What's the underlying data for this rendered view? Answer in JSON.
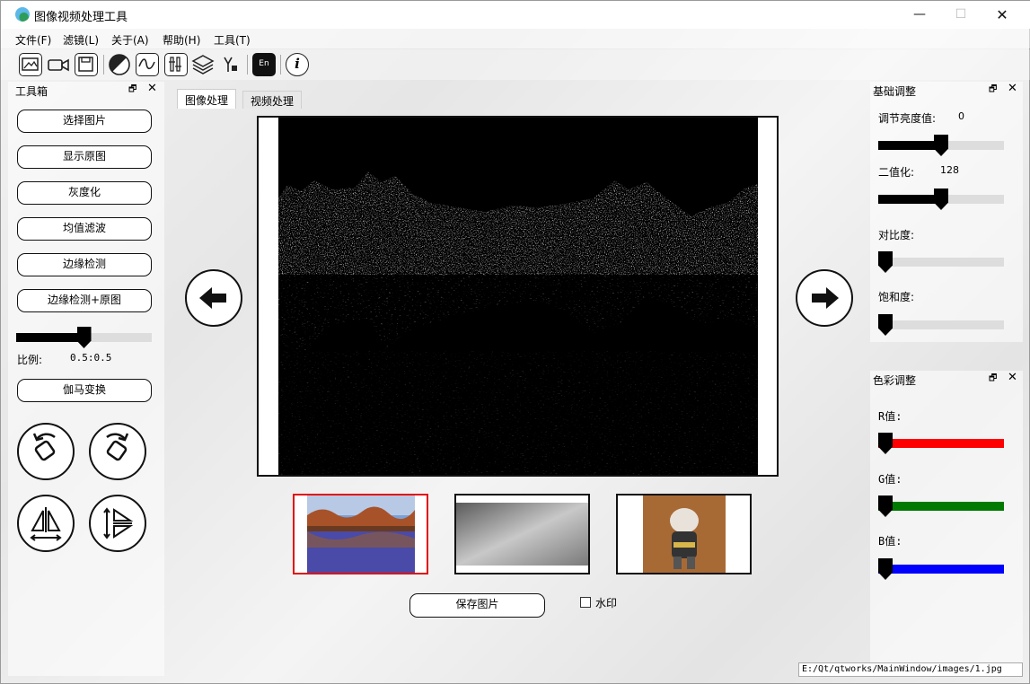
{
  "window": {
    "title": "图像视频处理工具",
    "controls": {
      "minimize": "—",
      "maximize": "☐",
      "close": "✕"
    }
  },
  "menu": [
    "文件(F)",
    "滤镜(L)",
    "关于(A)",
    "帮助(H)",
    "工具(T)"
  ],
  "toolbar": {
    "icons": [
      "open-image-icon",
      "video-camera-icon",
      "save-disk-icon",
      "grayscale-icon",
      "wave-filter-icon",
      "adjust-icon",
      "layers-icon",
      "cursor-tool-icon",
      "translate-icon",
      "info-icon"
    ],
    "info_glyph": "i",
    "translate_glyph": "En"
  },
  "toolbox": {
    "title": "工具箱",
    "buttons": {
      "select": "选择图片",
      "original": "显示原图",
      "gray": "灰度化",
      "mean_filter": "均值滤波",
      "edge": "边缘检测",
      "edge_original": "边缘检测+原图",
      "gamma": "伽马变换"
    },
    "ratio_label": "比例:",
    "ratio_value": "0.5:0.5",
    "ratio_slider": 0.5
  },
  "tabs": [
    "图像处理",
    "视频处理"
  ],
  "actions": {
    "save": "保存图片",
    "watermark": "水印",
    "watermark_checked": false
  },
  "basic_adjust": {
    "title": "基础调整",
    "brightness_label": "调节亮度值:",
    "brightness_value": "0",
    "brightness_slider": 0.5,
    "binary_label": "二值化:",
    "binary_value": "128",
    "binary_slider": 0.5,
    "contrast_label": "对比度:",
    "contrast_slider": 0.0,
    "saturation_label": "饱和度:",
    "saturation_slider": 0.0
  },
  "color_adjust": {
    "title": "色彩调整",
    "r_label": "R值:",
    "g_label": "G值:",
    "b_label": "B值:",
    "r_slider": 0.0,
    "g_slider": 0.0,
    "b_slider": 0.0,
    "r_color": "#ff0000",
    "g_color": "#007a00",
    "b_color": "#0000ff"
  },
  "dock_controls": {
    "float": "🗗",
    "close": "✕"
  },
  "status": "E:/Qt/qtworks/MainWindow/images/1.jpg"
}
